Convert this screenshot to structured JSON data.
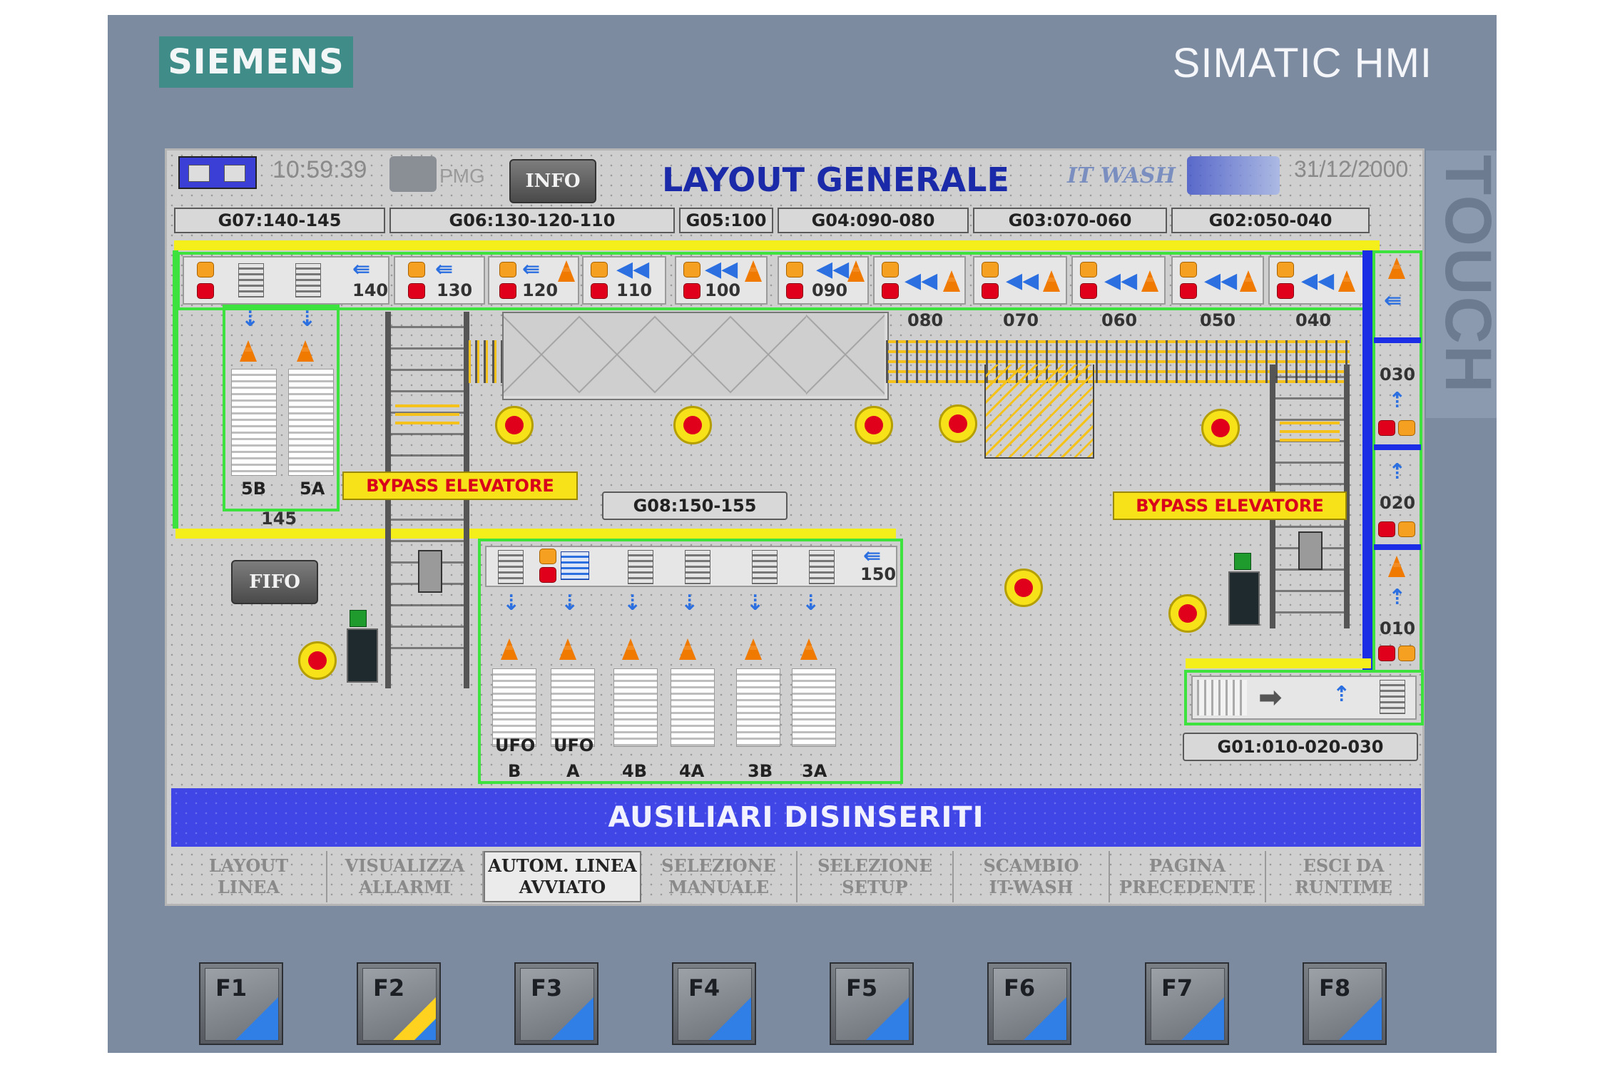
{
  "panel": {
    "brand": "SIEMENS",
    "model": "SIMATIC HMI",
    "side_label": "TOUCH",
    "function_keys": [
      {
        "label": "F1",
        "led": "blue"
      },
      {
        "label": "F2",
        "led": "yellow"
      },
      {
        "label": "F3",
        "led": "blue"
      },
      {
        "label": "F4",
        "led": "blue"
      },
      {
        "label": "F5",
        "led": "blue"
      },
      {
        "label": "F6",
        "led": "blue"
      },
      {
        "label": "F7",
        "led": "blue"
      },
      {
        "label": "F8",
        "led": "blue"
      }
    ]
  },
  "header": {
    "time": "10:59:39",
    "pmg_logo": "PMG",
    "info_button": "INFO",
    "title": "LAYOUT GENERALE",
    "itwash_logo": "IT WASH",
    "date": "31/12/2000"
  },
  "groups": {
    "g07": "G07:140-145",
    "g06": "G06:130-120-110",
    "g05": "G05:100",
    "g04": "G04:090-080",
    "g03": "G03:070-060",
    "g02": "G02:050-040",
    "g08": "G08:150-155",
    "g01": "G01:010-020-030"
  },
  "stations": {
    "s140": "140",
    "s130": "130",
    "s120": "120",
    "s110": "110",
    "s100": "100",
    "s090": "090",
    "s080": "080",
    "s070": "070",
    "s060": "060",
    "s050": "050",
    "s040": "040",
    "s030": "030",
    "s020": "020",
    "s010": "010",
    "s145": "145",
    "s150": "150"
  },
  "lanes": {
    "l5b": "5B",
    "l5a": "5A",
    "ufo_b_top": "UFO",
    "ufo_b_bottom": "B",
    "ufo_a_top": "UFO",
    "ufo_a_bottom": "A",
    "l4b": "4B",
    "l4a": "4A",
    "l3b": "3B",
    "l3a": "3A"
  },
  "labels": {
    "bypass_left": "BYPASS ELEVATORE",
    "bypass_right": "BYPASS ELEVATORE",
    "fifo": "FIFO"
  },
  "status_bar": "AUSILIARI DISINSERITI",
  "softkeys": [
    {
      "line1": "LAYOUT",
      "line2": "LINEA",
      "active": false
    },
    {
      "line1": "VISUALIZZA",
      "line2": "ALLARMI",
      "active": false
    },
    {
      "line1": "AUTOM. LINEA",
      "line2": "AVVIATO",
      "active": true
    },
    {
      "line1": "SELEZIONE",
      "line2": "MANUALE",
      "active": false
    },
    {
      "line1": "SELEZIONE",
      "line2": "SETUP",
      "active": false
    },
    {
      "line1": "SCAMBIO",
      "line2": "IT-WASH",
      "active": false
    },
    {
      "line1": "PAGINA",
      "line2": "PRECEDENTE",
      "active": false
    },
    {
      "line1": "ESCI DA",
      "line2": "RUNTIME",
      "active": false
    }
  ],
  "colors": {
    "bezel": "#7d8ba1",
    "screen_bg": "#cfcfcf",
    "status_bar": "#4046e6",
    "title": "#1b2aa8",
    "zone_border": "#3ee23e",
    "conveyor_yellow": "#f4ee1a",
    "alarm_red": "#e0001b"
  }
}
